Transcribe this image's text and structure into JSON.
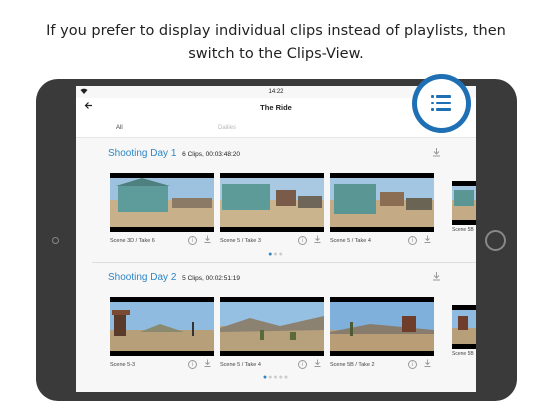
{
  "caption": {
    "line1": "If you prefer to display individual clips instead of playlists, then",
    "line2": "switch to the Clips-View."
  },
  "statusbar": {
    "time": "14:22",
    "wifi_icon": "wifi-icon"
  },
  "navbar": {
    "back_icon": "back-arrow-icon",
    "title": "The Ride"
  },
  "tabs": [
    {
      "label": "All"
    },
    {
      "label": "Dailies"
    }
  ],
  "fab": {
    "icon": "list-view-icon",
    "color": "#1f6fb5"
  },
  "sections": [
    {
      "title": "Shooting Day 1",
      "meta": "6 Clips, 00:03:48:20",
      "clips": [
        {
          "label": "Scene 3D  / Take 6"
        },
        {
          "label": "Scene 5  / Take 3"
        },
        {
          "label": "Scene 5  / Take 4"
        },
        {
          "label": "Scene 5B"
        }
      ],
      "pager": "●●●"
    },
    {
      "title": "Shooting Day 2",
      "meta": "5 Clips, 00:02:51:19",
      "clips": [
        {
          "label": "Scene 5-3"
        },
        {
          "label": "Scene 5  / Take 4"
        },
        {
          "label": "Scene 5B  / Take 2"
        },
        {
          "label": "Scene 5B"
        }
      ],
      "pager": "●●●●●"
    }
  ],
  "accent_color": "#2f86c7"
}
